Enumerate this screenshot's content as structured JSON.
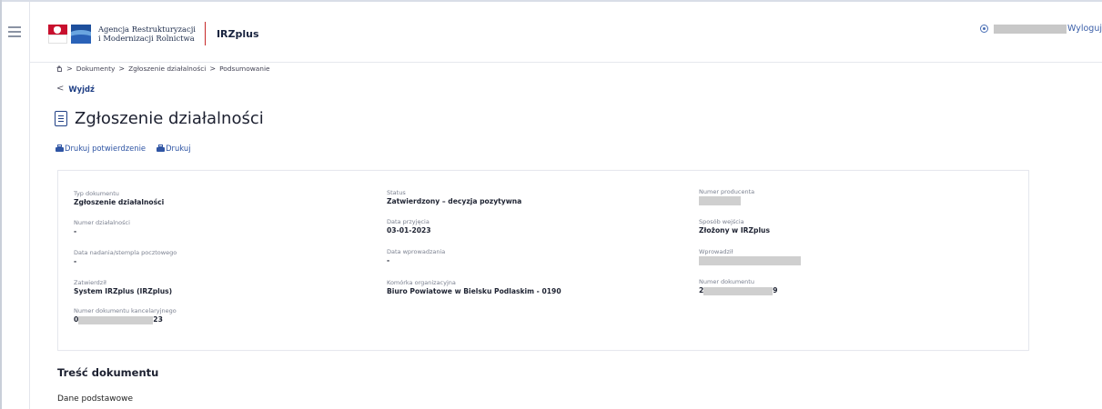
{
  "header": {
    "agency_line1": "Agencja Restrukturyzacji",
    "agency_line2": "i Modernizacji Rolnictwa",
    "app_name": "IRZplus",
    "logout_label": "Wyloguj"
  },
  "breadcrumb": {
    "items": [
      "Dokumenty",
      "Zgłoszenie działalności",
      "Podsumowanie"
    ],
    "separator": ">"
  },
  "back": {
    "label": "Wyjdź",
    "chevron": "<"
  },
  "page": {
    "title": "Zgłoszenie działalności"
  },
  "actions": {
    "print_confirmation": "Drukuj potwierdzenie",
    "print": "Drukuj"
  },
  "details": {
    "col1": [
      {
        "label": "Typ dokumentu",
        "value": "Zgłoszenie działalności"
      },
      {
        "label": "Numer działalności",
        "value": "-"
      },
      {
        "label": "Data nadania/stempla pocztowego",
        "value": "-"
      },
      {
        "label": "Zatwierdził",
        "value": "System IRZplus (IRZplus)"
      },
      {
        "label": "Numer dokumentu kancelaryjnego",
        "value_prefix": "0",
        "value_suffix": "23"
      }
    ],
    "col2": [
      {
        "label": "Status",
        "value": "Zatwierdzony – decyzja pozytywna"
      },
      {
        "label": "Data przyjęcia",
        "value": "03-01-2023"
      },
      {
        "label": "Data wprowadzania",
        "value": "-"
      },
      {
        "label": "Komórka organizacyjna",
        "value": "Biuro Powiatowe w Bielsku Podlaskim - 0190"
      }
    ],
    "col3": [
      {
        "label": "Numer producenta"
      },
      {
        "label": "Sposób wejścia",
        "value": "Złożony w IRZplus"
      },
      {
        "label": "Wprowadził"
      },
      {
        "label": "Numer dokumentu",
        "value_prefix": "2",
        "value_suffix": "9"
      }
    ]
  },
  "content": {
    "section_title": "Treść dokumentu",
    "subsection": "Dane podstawowe"
  },
  "colors": {
    "accent": "#1f3f85",
    "link": "#2f55a4",
    "brand_red": "#c62828"
  },
  "icons": [
    "menu-icon",
    "home-icon",
    "document-icon",
    "printer-icon",
    "user-icon",
    "chevron-left-icon"
  ]
}
